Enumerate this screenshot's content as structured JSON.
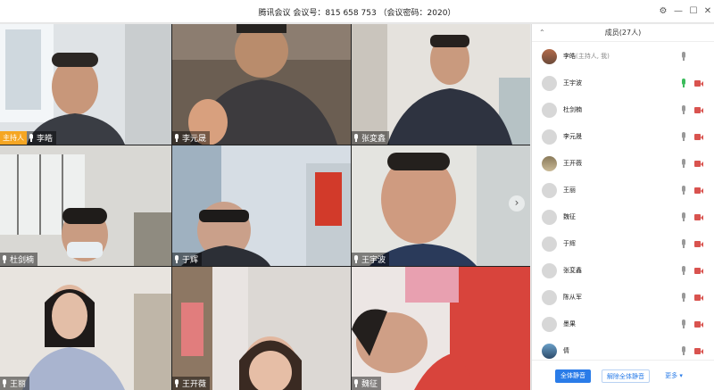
{
  "window": {
    "title": "腾讯会议 会议号：815 658 753 （会议密码：2020）",
    "controls": {
      "settings": "⚙",
      "minimize": "—",
      "maximize": "☐",
      "close": "✕"
    }
  },
  "video_tiles": [
    {
      "name": "李皓",
      "host_tag": "主持人"
    },
    {
      "name": "李元晟"
    },
    {
      "name": "张変鑫"
    },
    {
      "name": "杜剑楠"
    },
    {
      "name": "于辉"
    },
    {
      "name": "王宇波"
    },
    {
      "name": "王丽"
    },
    {
      "name": "王开薇"
    },
    {
      "name": "魏征"
    }
  ],
  "next_page_arrow": "›",
  "participants_panel": {
    "collapse_label": "⌃",
    "title": "成员(27人)",
    "members": [
      {
        "name": "李皓",
        "tag": "(主持人, 我)",
        "avatar": "photo",
        "mic_active": false
      },
      {
        "name": "王宇波",
        "avatar": "default",
        "mic_active": true
      },
      {
        "name": "杜剑楠",
        "avatar": "default",
        "mic_active": false
      },
      {
        "name": "李元晟",
        "avatar": "default",
        "mic_active": false
      },
      {
        "name": "王开薇",
        "avatar": "photo2",
        "mic_active": false
      },
      {
        "name": "王丽",
        "avatar": "default",
        "mic_active": false
      },
      {
        "name": "魏征",
        "avatar": "default",
        "mic_active": false
      },
      {
        "name": "于辉",
        "avatar": "default",
        "mic_active": false
      },
      {
        "name": "张変鑫",
        "avatar": "default",
        "mic_active": false
      },
      {
        "name": "陈从军",
        "avatar": "default",
        "mic_active": false
      },
      {
        "name": "墨果",
        "avatar": "default",
        "mic_active": false
      },
      {
        "name": "倩",
        "avatar": "photo3",
        "mic_active": false
      }
    ],
    "footer": {
      "mute_all": "全体静音",
      "unmute_all": "解除全体静音",
      "more": "更多 ▾"
    }
  }
}
